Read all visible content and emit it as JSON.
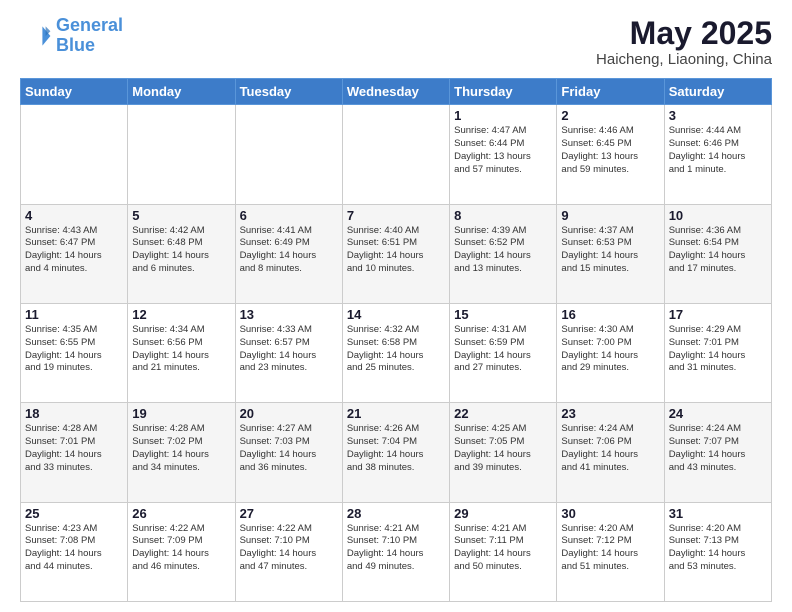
{
  "logo": {
    "line1": "General",
    "line2": "Blue"
  },
  "title": "May 2025",
  "subtitle": "Haicheng, Liaoning, China",
  "days_of_week": [
    "Sunday",
    "Monday",
    "Tuesday",
    "Wednesday",
    "Thursday",
    "Friday",
    "Saturday"
  ],
  "weeks": [
    [
      {
        "day": "",
        "info": ""
      },
      {
        "day": "",
        "info": ""
      },
      {
        "day": "",
        "info": ""
      },
      {
        "day": "",
        "info": ""
      },
      {
        "day": "1",
        "info": "Sunrise: 4:47 AM\nSunset: 6:44 PM\nDaylight: 13 hours\nand 57 minutes."
      },
      {
        "day": "2",
        "info": "Sunrise: 4:46 AM\nSunset: 6:45 PM\nDaylight: 13 hours\nand 59 minutes."
      },
      {
        "day": "3",
        "info": "Sunrise: 4:44 AM\nSunset: 6:46 PM\nDaylight: 14 hours\nand 1 minute."
      }
    ],
    [
      {
        "day": "4",
        "info": "Sunrise: 4:43 AM\nSunset: 6:47 PM\nDaylight: 14 hours\nand 4 minutes."
      },
      {
        "day": "5",
        "info": "Sunrise: 4:42 AM\nSunset: 6:48 PM\nDaylight: 14 hours\nand 6 minutes."
      },
      {
        "day": "6",
        "info": "Sunrise: 4:41 AM\nSunset: 6:49 PM\nDaylight: 14 hours\nand 8 minutes."
      },
      {
        "day": "7",
        "info": "Sunrise: 4:40 AM\nSunset: 6:51 PM\nDaylight: 14 hours\nand 10 minutes."
      },
      {
        "day": "8",
        "info": "Sunrise: 4:39 AM\nSunset: 6:52 PM\nDaylight: 14 hours\nand 13 minutes."
      },
      {
        "day": "9",
        "info": "Sunrise: 4:37 AM\nSunset: 6:53 PM\nDaylight: 14 hours\nand 15 minutes."
      },
      {
        "day": "10",
        "info": "Sunrise: 4:36 AM\nSunset: 6:54 PM\nDaylight: 14 hours\nand 17 minutes."
      }
    ],
    [
      {
        "day": "11",
        "info": "Sunrise: 4:35 AM\nSunset: 6:55 PM\nDaylight: 14 hours\nand 19 minutes."
      },
      {
        "day": "12",
        "info": "Sunrise: 4:34 AM\nSunset: 6:56 PM\nDaylight: 14 hours\nand 21 minutes."
      },
      {
        "day": "13",
        "info": "Sunrise: 4:33 AM\nSunset: 6:57 PM\nDaylight: 14 hours\nand 23 minutes."
      },
      {
        "day": "14",
        "info": "Sunrise: 4:32 AM\nSunset: 6:58 PM\nDaylight: 14 hours\nand 25 minutes."
      },
      {
        "day": "15",
        "info": "Sunrise: 4:31 AM\nSunset: 6:59 PM\nDaylight: 14 hours\nand 27 minutes."
      },
      {
        "day": "16",
        "info": "Sunrise: 4:30 AM\nSunset: 7:00 PM\nDaylight: 14 hours\nand 29 minutes."
      },
      {
        "day": "17",
        "info": "Sunrise: 4:29 AM\nSunset: 7:01 PM\nDaylight: 14 hours\nand 31 minutes."
      }
    ],
    [
      {
        "day": "18",
        "info": "Sunrise: 4:28 AM\nSunset: 7:01 PM\nDaylight: 14 hours\nand 33 minutes."
      },
      {
        "day": "19",
        "info": "Sunrise: 4:28 AM\nSunset: 7:02 PM\nDaylight: 14 hours\nand 34 minutes."
      },
      {
        "day": "20",
        "info": "Sunrise: 4:27 AM\nSunset: 7:03 PM\nDaylight: 14 hours\nand 36 minutes."
      },
      {
        "day": "21",
        "info": "Sunrise: 4:26 AM\nSunset: 7:04 PM\nDaylight: 14 hours\nand 38 minutes."
      },
      {
        "day": "22",
        "info": "Sunrise: 4:25 AM\nSunset: 7:05 PM\nDaylight: 14 hours\nand 39 minutes."
      },
      {
        "day": "23",
        "info": "Sunrise: 4:24 AM\nSunset: 7:06 PM\nDaylight: 14 hours\nand 41 minutes."
      },
      {
        "day": "24",
        "info": "Sunrise: 4:24 AM\nSunset: 7:07 PM\nDaylight: 14 hours\nand 43 minutes."
      }
    ],
    [
      {
        "day": "25",
        "info": "Sunrise: 4:23 AM\nSunset: 7:08 PM\nDaylight: 14 hours\nand 44 minutes."
      },
      {
        "day": "26",
        "info": "Sunrise: 4:22 AM\nSunset: 7:09 PM\nDaylight: 14 hours\nand 46 minutes."
      },
      {
        "day": "27",
        "info": "Sunrise: 4:22 AM\nSunset: 7:10 PM\nDaylight: 14 hours\nand 47 minutes."
      },
      {
        "day": "28",
        "info": "Sunrise: 4:21 AM\nSunset: 7:10 PM\nDaylight: 14 hours\nand 49 minutes."
      },
      {
        "day": "29",
        "info": "Sunrise: 4:21 AM\nSunset: 7:11 PM\nDaylight: 14 hours\nand 50 minutes."
      },
      {
        "day": "30",
        "info": "Sunrise: 4:20 AM\nSunset: 7:12 PM\nDaylight: 14 hours\nand 51 minutes."
      },
      {
        "day": "31",
        "info": "Sunrise: 4:20 AM\nSunset: 7:13 PM\nDaylight: 14 hours\nand 53 minutes."
      }
    ]
  ]
}
